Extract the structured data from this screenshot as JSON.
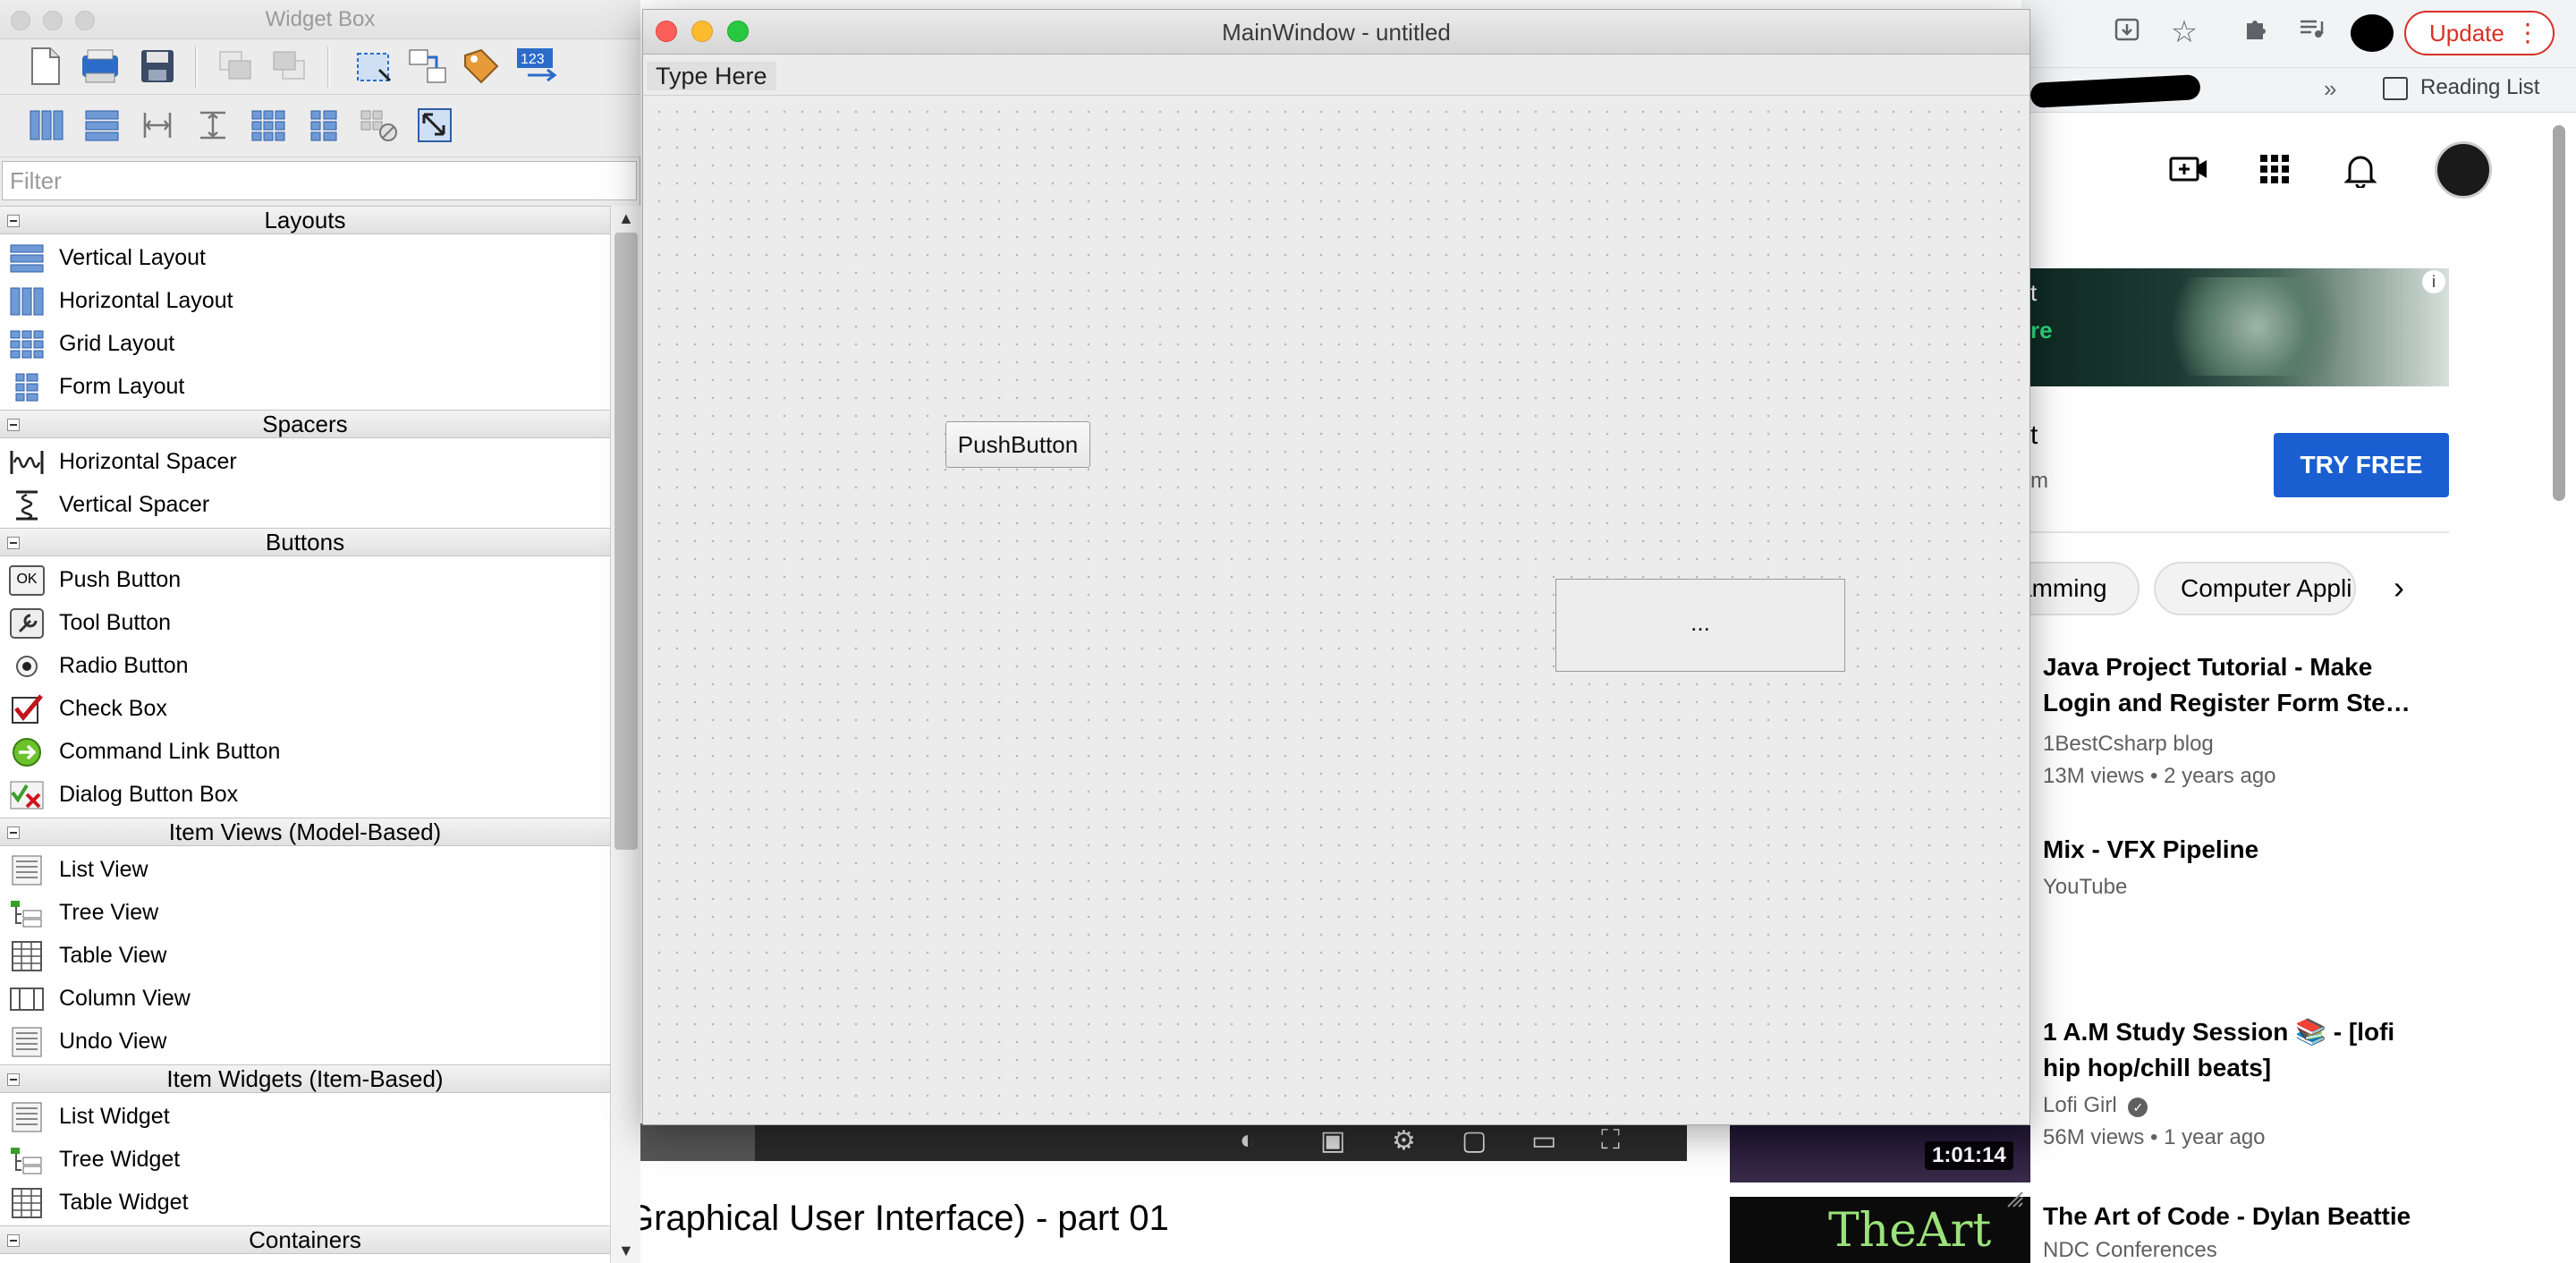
{
  "browser": {
    "update_label": "Update",
    "reading_list_label": "Reading List",
    "overflow": "»",
    "ad": {
      "line1": "t",
      "line2": "re",
      "title_fragment": "t",
      "subtitle_fragment": "m",
      "cta_label": "TRY FREE"
    },
    "chips": [
      "amming",
      "Computer Appli"
    ],
    "videos": [
      {
        "title": "Java Project Tutorial - Make Login and Register Form Ste…",
        "channel": "1BestCsharp blog",
        "meta": "13M views • 2 years ago"
      },
      {
        "title": "Mix - VFX Pipeline",
        "channel": "YouTube",
        "meta": ""
      },
      {
        "title": "1 A.M Study Session 📚 - [lofi hip hop/chill beats]",
        "channel": "Lofi Girl",
        "meta": "56M views • 1 year ago",
        "duration": "1:01:14"
      },
      {
        "title": "The Art of Code - Dylan Beattie",
        "channel": "NDC Conferences",
        "meta": "",
        "thumb_text": "TheArt of"
      }
    ],
    "player_title_fragment": "Graphical User Interface) - part 01"
  },
  "widget_box": {
    "title": "Widget Box",
    "filter_placeholder": "Filter",
    "categories": {
      "layouts": "Layouts",
      "spacers": "Spacers",
      "buttons": "Buttons",
      "item_views": "Item Views (Model-Based)",
      "item_widgets": "Item Widgets (Item-Based)",
      "containers": "Containers"
    },
    "items": {
      "vertical_layout": "Vertical Layout",
      "horizontal_layout": "Horizontal Layout",
      "grid_layout": "Grid Layout",
      "form_layout": "Form Layout",
      "horizontal_spacer": "Horizontal Spacer",
      "vertical_spacer": "Vertical Spacer",
      "push_button": "Push Button",
      "tool_button": "Tool Button",
      "radio_button": "Radio Button",
      "check_box": "Check Box",
      "command_link_button": "Command Link Button",
      "dialog_button_box": "Dialog Button Box",
      "list_view": "List View",
      "tree_view": "Tree View",
      "table_view": "Table View",
      "column_view": "Column View",
      "undo_view": "Undo View",
      "list_widget": "List Widget",
      "tree_widget": "Tree Widget",
      "table_widget": "Table Widget"
    },
    "ok_icon_text": "OK"
  },
  "main_window": {
    "title": "MainWindow - untitled",
    "menu_placeholder": "Type Here",
    "push_button_label": "PushButton",
    "ellipsis_button_label": "..."
  },
  "colors": {
    "youtube_cta": "#1a5fd1",
    "update_red": "#d93025",
    "close_red": "#fc5f57",
    "minimize_yellow": "#fdbc2e",
    "zoom_green": "#28c840"
  }
}
